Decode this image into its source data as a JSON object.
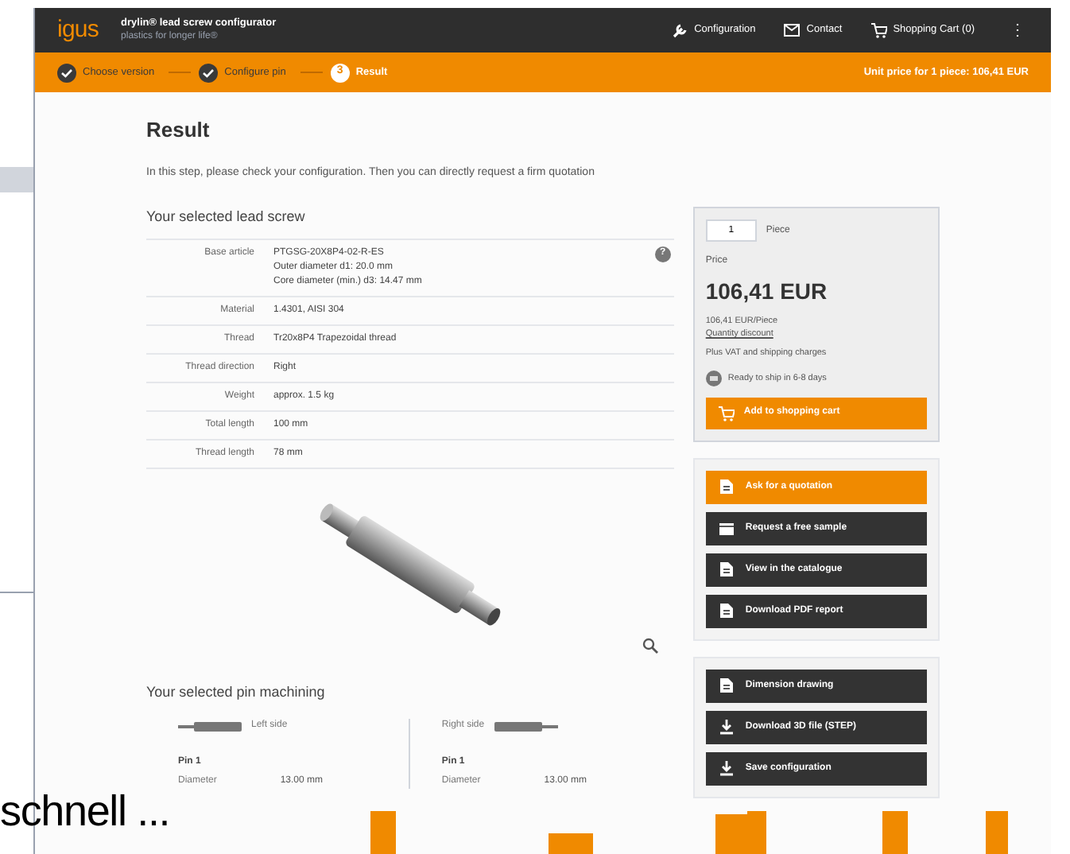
{
  "header": {
    "logo": "igus",
    "title": "drylin® lead screw configurator",
    "subtitle": "plastics for longer life®",
    "nav": [
      {
        "label": "Configuration"
      },
      {
        "label": "Contact"
      },
      {
        "label": "Shopping Cart (0)"
      }
    ],
    "menu": "⋮"
  },
  "steps": [
    {
      "label": "Choose version",
      "completed": true
    },
    {
      "label": "Configure pin",
      "completed": true
    },
    {
      "number": "3",
      "label": "Result",
      "completed": false
    }
  ],
  "unit_price": "Unit price for 1 piece: 106,41 EUR",
  "title": "Result",
  "intro": "In this step, please check your configuration. Then you can directly request a firm quotation",
  "lead_screw": {
    "heading": "Your selected lead screw",
    "rows": [
      {
        "label": "Base article",
        "lines": [
          "PTGSG-20X8P4-02-R-ES",
          "Outer diameter d1: 20.0 mm",
          "Core diameter (min.) d3: 14.47 mm"
        ],
        "help": "?"
      },
      {
        "label": "Material",
        "lines": [
          "1.4301, AISI 304"
        ]
      },
      {
        "label": "Thread",
        "lines": [
          "Tr20x8P4 Trapezoidal thread"
        ]
      },
      {
        "label": "Thread direction",
        "lines": [
          "Right"
        ]
      },
      {
        "label": "Weight",
        "lines": [
          "approx. 1.5 kg"
        ]
      },
      {
        "label": "Total length",
        "lines": [
          "100 mm"
        ]
      },
      {
        "label": "Thread length",
        "lines": [
          "78 mm"
        ]
      }
    ]
  },
  "pin_machining": {
    "heading": "Your selected pin machining",
    "sides": [
      {
        "label": "Left side",
        "pin": "Pin 1",
        "field": "Diameter",
        "value": "13.00 mm"
      },
      {
        "label": "Right side",
        "pin": "Pin 1",
        "field": "Diameter",
        "value": "13.00 mm"
      }
    ]
  },
  "order": {
    "quantity": "1",
    "unit": "Piece",
    "price_label": "Price",
    "price": "106,41 EUR",
    "per_piece": "106,41 EUR/Piece",
    "discount_link": "Quantity discount",
    "vat_note": "Plus VAT and shipping charges",
    "delivery": "Ready to ship in 6-8 days",
    "cart_button": "Add to shopping cart"
  },
  "actions": [
    {
      "label": "Ask for a quotation",
      "kind": "primary"
    },
    {
      "label": "Request a free sample",
      "kind": "dark"
    },
    {
      "label": "View in the catalogue",
      "kind": "dark"
    },
    {
      "label": "Download PDF report",
      "kind": "dark"
    }
  ],
  "files": [
    {
      "label": "Dimension drawing",
      "kind": "dark"
    },
    {
      "label": "Download 3D file (STEP)",
      "kind": "dark"
    },
    {
      "label": "Save configuration",
      "kind": "dark"
    }
  ],
  "caption": "schnell ..."
}
